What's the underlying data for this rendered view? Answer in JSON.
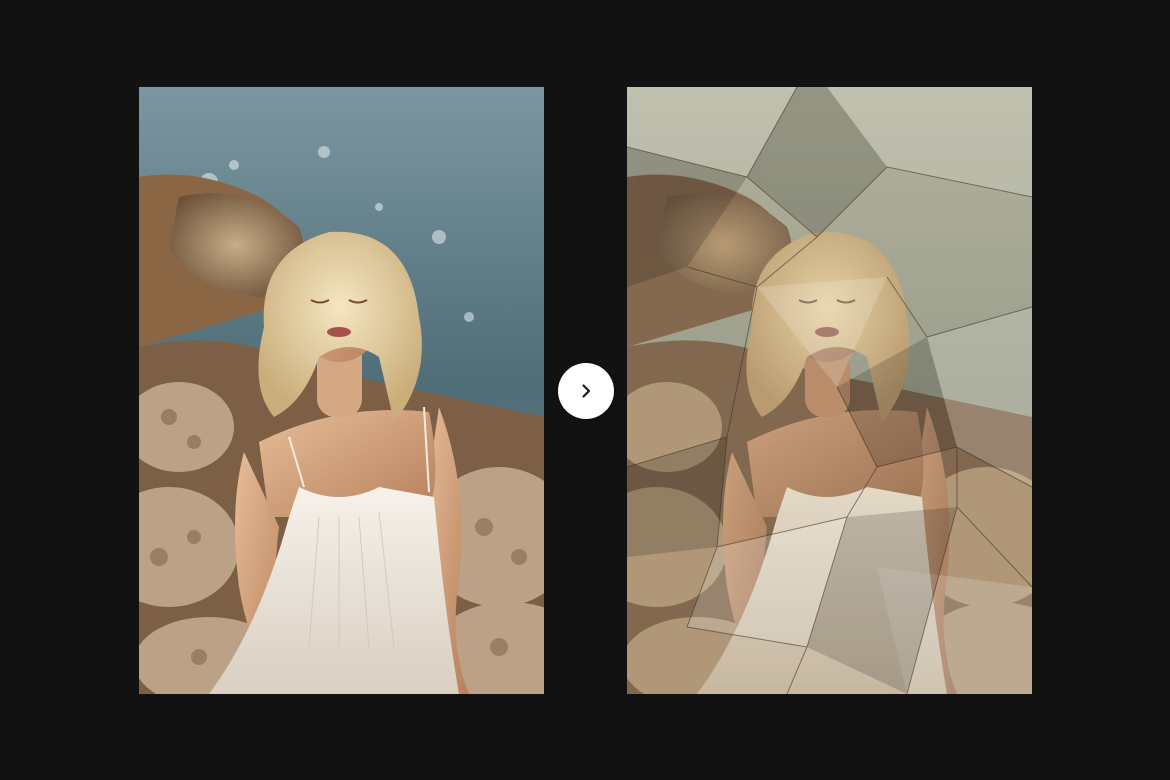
{
  "colors": {
    "background": "#121213",
    "button": "#ffffff",
    "arrow": "#1a1a1a",
    "sea": "#5c7a84",
    "rock": "#a58664",
    "hair": "#e7d4a8",
    "skin": "#d2a27c",
    "dress": "#efe8de",
    "paper_tint": "#c7b596"
  },
  "before_image": {
    "description_icon": "photo-woman-rocks"
  },
  "after_image": {
    "description_icon": "photo-woman-rocks-crumpled-paper"
  },
  "compare_button": {
    "icon": "chevron-right-icon"
  }
}
